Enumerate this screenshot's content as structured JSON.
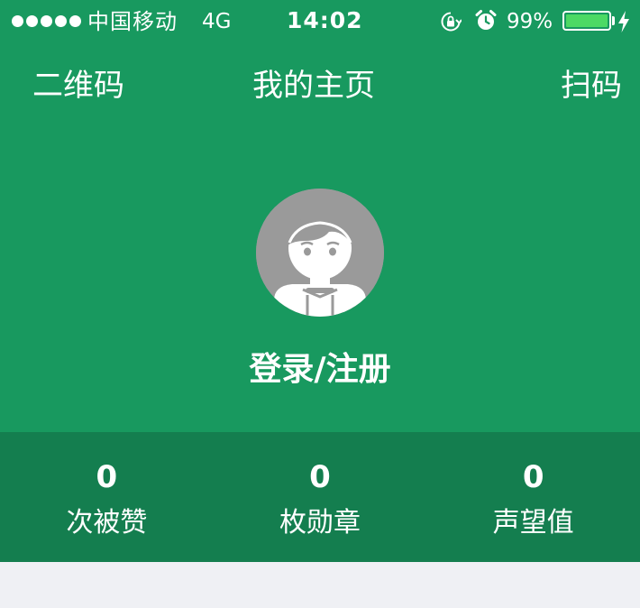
{
  "status_bar": {
    "carrier": "中国移动",
    "network": "4G",
    "time": "14:02",
    "battery_percent": "99%",
    "battery_level": 0.99,
    "icons": [
      "signal-dots-icon",
      "orientation-lock-icon",
      "alarm-clock-icon",
      "battery-icon",
      "charging-bolt-icon"
    ]
  },
  "nav": {
    "left_label": "二维码",
    "title": "我的主页",
    "right_label": "扫码"
  },
  "profile": {
    "avatar_icon": "default-avatar-icon",
    "login_label": "登录/注册"
  },
  "stats": [
    {
      "value": "0",
      "label": "次被赞"
    },
    {
      "value": "0",
      "label": "枚勋章"
    },
    {
      "value": "0",
      "label": "声望值"
    }
  ],
  "colors": {
    "primary_green": "#18995f",
    "stats_green": "#147e4f",
    "background": "#eff0f4",
    "battery_green": "#4cd964",
    "avatar_gray": "#9a9a9a"
  }
}
